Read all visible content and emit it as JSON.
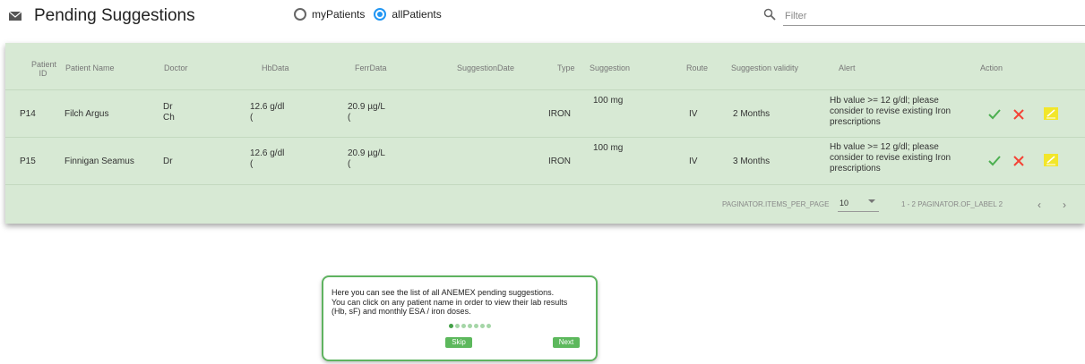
{
  "header": {
    "title": "Pending Suggestions",
    "radio_options": [
      {
        "label": "myPatients",
        "selected": false
      },
      {
        "label": "allPatients",
        "selected": true
      }
    ],
    "filter_placeholder": "Filter"
  },
  "table": {
    "columns": {
      "patient_id_1": "Patient",
      "patient_id_2": "ID",
      "patient_name": "Patient Name",
      "doctor": "Doctor",
      "hbdata": "HbData",
      "ferrdata": "FerrData",
      "suggestion_date": "SuggestionDate",
      "type": "Type",
      "suggestion": "Suggestion",
      "route": "Route",
      "validity": "Suggestion validity",
      "alert": "Alert",
      "action": "Action"
    },
    "rows": [
      {
        "id": "P14",
        "name": "Filch Argus",
        "doctor_line1": "Dr",
        "doctor_line2": "Ch",
        "hb_line1": "12.6 g/dl",
        "hb_line2": "(",
        "ferr_line1": "20.9 µg/L",
        "ferr_line2": "(",
        "date": "",
        "type": "IRON",
        "suggestion": "100 mg",
        "route": "IV",
        "validity": "2 Months",
        "alert_line1": "Hb value >= 12 g/dl; please",
        "alert_line2": "consider to revise existing Iron",
        "alert_line3": "prescriptions"
      },
      {
        "id": "P15",
        "name": "Finnigan Seamus",
        "doctor_line1": "Dr",
        "doctor_line2": "",
        "hb_line1": "12.6 g/dl",
        "hb_line2": "(",
        "ferr_line1": "20.9 µg/L",
        "ferr_line2": "(",
        "date": "",
        "type": "IRON",
        "suggestion": "100 mg",
        "route": "IV",
        "validity": "3 Months",
        "alert_line1": "Hb value >= 12 g/dl; please",
        "alert_line2": "consider to revise existing Iron",
        "alert_line3": "prescriptions"
      }
    ],
    "action_icons": [
      "check-icon",
      "close-icon",
      "edit-icon"
    ],
    "colors": {
      "check": "#4caf50",
      "close": "#f44336",
      "edit": "#f2e62a",
      "card_bg": "#d7e9d4"
    }
  },
  "paginator": {
    "items_per_page_label": "PAGINATOR.ITEMS_PER_PAGE",
    "items_per_page_value": "10",
    "range_label": "1 - 2 PAGINATOR.OF_LABEL 2"
  },
  "tour": {
    "line1": "Here you can see the list of all ANEMEX pending suggestions.",
    "line2": "You can click on any patient name in order to view their lab results",
    "line3": "(Hb, sF) and monthly ESA / iron doses.",
    "skip_label": "Skip",
    "next_label": "Next",
    "step_count": 7,
    "current_step": 1
  }
}
